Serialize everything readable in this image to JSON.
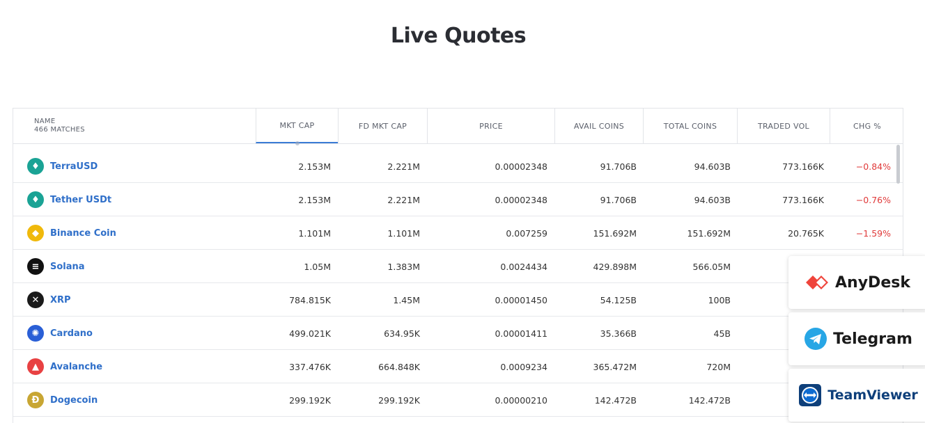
{
  "page": {
    "title": "Live Quotes"
  },
  "table": {
    "name_header": "NAME",
    "matches": "466 MATCHES",
    "columns": [
      "MKT CAP",
      "FD MKT CAP",
      "PRICE",
      "AVAIL COINS",
      "TOTAL COINS",
      "TRADED VOL",
      "CHG %"
    ],
    "rows": [
      {
        "name": "TerraUSD",
        "icon": "terrausd-icon",
        "icon_color": "#1aa395",
        "mktcap": "2.153M",
        "fdmktcap": "2.221M",
        "price": "0.00002348",
        "avail": "91.706B",
        "total": "94.603B",
        "vol": "773.166K",
        "chg": "−0.84%",
        "dir": "neg"
      },
      {
        "name": "Tether USDt",
        "icon": "tether-icon",
        "icon_color": "#1aa395",
        "mktcap": "2.153M",
        "fdmktcap": "2.221M",
        "price": "0.00002348",
        "avail": "91.706B",
        "total": "94.603B",
        "vol": "773.166K",
        "chg": "−0.76%",
        "dir": "neg"
      },
      {
        "name": "Binance Coin",
        "icon": "binance-icon",
        "icon_color": "#f0b90b",
        "mktcap": "1.101M",
        "fdmktcap": "1.101M",
        "price": "0.007259",
        "avail": "151.692M",
        "total": "151.692M",
        "vol": "20.765K",
        "chg": "−1.59%",
        "dir": "neg"
      },
      {
        "name": "Solana",
        "icon": "solana-icon",
        "icon_color": "#111111",
        "mktcap": "1.05M",
        "fdmktcap": "1.383M",
        "price": "0.0024434",
        "avail": "429.898M",
        "total": "566.05M",
        "vol": "",
        "chg": "",
        "dir": "neg"
      },
      {
        "name": "XRP",
        "icon": "xrp-icon",
        "icon_color": "#1a1a1a",
        "mktcap": "784.815K",
        "fdmktcap": "1.45M",
        "price": "0.00001450",
        "avail": "54.125B",
        "total": "100B",
        "vol": "",
        "chg": "",
        "dir": "neg"
      },
      {
        "name": "Cardano",
        "icon": "cardano-icon",
        "icon_color": "#2a5fd6",
        "mktcap": "499.021K",
        "fdmktcap": "634.95K",
        "price": "0.00001411",
        "avail": "35.366B",
        "total": "45B",
        "vol": "",
        "chg": "",
        "dir": "neg"
      },
      {
        "name": "Avalanche",
        "icon": "avalanche-icon",
        "icon_color": "#e84142",
        "mktcap": "337.476K",
        "fdmktcap": "664.848K",
        "price": "0.0009234",
        "avail": "365.472M",
        "total": "720M",
        "vol": "",
        "chg": "",
        "dir": "pos"
      },
      {
        "name": "Dogecoin",
        "icon": "dogecoin-icon",
        "icon_color": "#c8a633",
        "mktcap": "299.192K",
        "fdmktcap": "299.192K",
        "price": "0.00000210",
        "avail": "142.472B",
        "total": "142.472B",
        "vol": "",
        "chg": "",
        "dir": "neg"
      }
    ]
  },
  "floating": {
    "anydesk": "AnyDesk",
    "telegram": "Telegram",
    "teamviewer": "TeamViewer"
  },
  "colors": {
    "link": "#2f6fc9",
    "negative": "#e03a3a",
    "positive": "#1aa37a",
    "accent": "#3a7bd5"
  }
}
